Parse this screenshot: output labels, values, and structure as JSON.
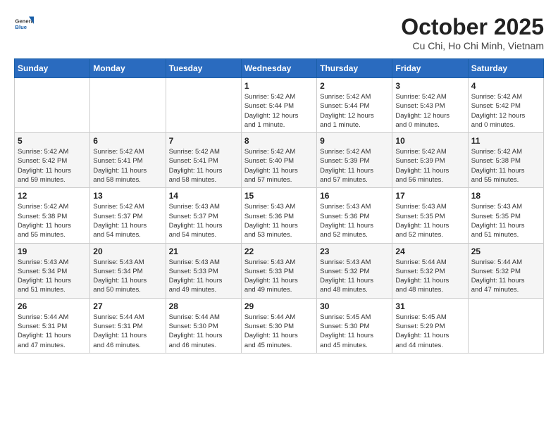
{
  "header": {
    "logo": {
      "general": "General",
      "blue": "Blue"
    },
    "title": "October 2025",
    "location": "Cu Chi, Ho Chi Minh, Vietnam"
  },
  "weekdays": [
    "Sunday",
    "Monday",
    "Tuesday",
    "Wednesday",
    "Thursday",
    "Friday",
    "Saturday"
  ],
  "weeks": [
    [
      {
        "day": "",
        "info": ""
      },
      {
        "day": "",
        "info": ""
      },
      {
        "day": "",
        "info": ""
      },
      {
        "day": "1",
        "info": "Sunrise: 5:42 AM\nSunset: 5:44 PM\nDaylight: 12 hours\nand 1 minute."
      },
      {
        "day": "2",
        "info": "Sunrise: 5:42 AM\nSunset: 5:44 PM\nDaylight: 12 hours\nand 1 minute."
      },
      {
        "day": "3",
        "info": "Sunrise: 5:42 AM\nSunset: 5:43 PM\nDaylight: 12 hours\nand 0 minutes."
      },
      {
        "day": "4",
        "info": "Sunrise: 5:42 AM\nSunset: 5:42 PM\nDaylight: 12 hours\nand 0 minutes."
      }
    ],
    [
      {
        "day": "5",
        "info": "Sunrise: 5:42 AM\nSunset: 5:42 PM\nDaylight: 11 hours\nand 59 minutes."
      },
      {
        "day": "6",
        "info": "Sunrise: 5:42 AM\nSunset: 5:41 PM\nDaylight: 11 hours\nand 58 minutes."
      },
      {
        "day": "7",
        "info": "Sunrise: 5:42 AM\nSunset: 5:41 PM\nDaylight: 11 hours\nand 58 minutes."
      },
      {
        "day": "8",
        "info": "Sunrise: 5:42 AM\nSunset: 5:40 PM\nDaylight: 11 hours\nand 57 minutes."
      },
      {
        "day": "9",
        "info": "Sunrise: 5:42 AM\nSunset: 5:39 PM\nDaylight: 11 hours\nand 57 minutes."
      },
      {
        "day": "10",
        "info": "Sunrise: 5:42 AM\nSunset: 5:39 PM\nDaylight: 11 hours\nand 56 minutes."
      },
      {
        "day": "11",
        "info": "Sunrise: 5:42 AM\nSunset: 5:38 PM\nDaylight: 11 hours\nand 55 minutes."
      }
    ],
    [
      {
        "day": "12",
        "info": "Sunrise: 5:42 AM\nSunset: 5:38 PM\nDaylight: 11 hours\nand 55 minutes."
      },
      {
        "day": "13",
        "info": "Sunrise: 5:42 AM\nSunset: 5:37 PM\nDaylight: 11 hours\nand 54 minutes."
      },
      {
        "day": "14",
        "info": "Sunrise: 5:43 AM\nSunset: 5:37 PM\nDaylight: 11 hours\nand 54 minutes."
      },
      {
        "day": "15",
        "info": "Sunrise: 5:43 AM\nSunset: 5:36 PM\nDaylight: 11 hours\nand 53 minutes."
      },
      {
        "day": "16",
        "info": "Sunrise: 5:43 AM\nSunset: 5:36 PM\nDaylight: 11 hours\nand 52 minutes."
      },
      {
        "day": "17",
        "info": "Sunrise: 5:43 AM\nSunset: 5:35 PM\nDaylight: 11 hours\nand 52 minutes."
      },
      {
        "day": "18",
        "info": "Sunrise: 5:43 AM\nSunset: 5:35 PM\nDaylight: 11 hours\nand 51 minutes."
      }
    ],
    [
      {
        "day": "19",
        "info": "Sunrise: 5:43 AM\nSunset: 5:34 PM\nDaylight: 11 hours\nand 51 minutes."
      },
      {
        "day": "20",
        "info": "Sunrise: 5:43 AM\nSunset: 5:34 PM\nDaylight: 11 hours\nand 50 minutes."
      },
      {
        "day": "21",
        "info": "Sunrise: 5:43 AM\nSunset: 5:33 PM\nDaylight: 11 hours\nand 49 minutes."
      },
      {
        "day": "22",
        "info": "Sunrise: 5:43 AM\nSunset: 5:33 PM\nDaylight: 11 hours\nand 49 minutes."
      },
      {
        "day": "23",
        "info": "Sunrise: 5:43 AM\nSunset: 5:32 PM\nDaylight: 11 hours\nand 48 minutes."
      },
      {
        "day": "24",
        "info": "Sunrise: 5:44 AM\nSunset: 5:32 PM\nDaylight: 11 hours\nand 48 minutes."
      },
      {
        "day": "25",
        "info": "Sunrise: 5:44 AM\nSunset: 5:32 PM\nDaylight: 11 hours\nand 47 minutes."
      }
    ],
    [
      {
        "day": "26",
        "info": "Sunrise: 5:44 AM\nSunset: 5:31 PM\nDaylight: 11 hours\nand 47 minutes."
      },
      {
        "day": "27",
        "info": "Sunrise: 5:44 AM\nSunset: 5:31 PM\nDaylight: 11 hours\nand 46 minutes."
      },
      {
        "day": "28",
        "info": "Sunrise: 5:44 AM\nSunset: 5:30 PM\nDaylight: 11 hours\nand 46 minutes."
      },
      {
        "day": "29",
        "info": "Sunrise: 5:44 AM\nSunset: 5:30 PM\nDaylight: 11 hours\nand 45 minutes."
      },
      {
        "day": "30",
        "info": "Sunrise: 5:45 AM\nSunset: 5:30 PM\nDaylight: 11 hours\nand 45 minutes."
      },
      {
        "day": "31",
        "info": "Sunrise: 5:45 AM\nSunset: 5:29 PM\nDaylight: 11 hours\nand 44 minutes."
      },
      {
        "day": "",
        "info": ""
      }
    ]
  ]
}
